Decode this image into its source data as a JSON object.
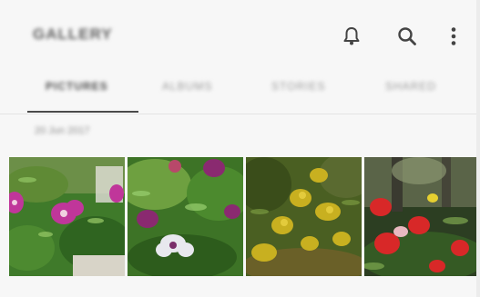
{
  "header": {
    "title": "GALLERY",
    "icons": [
      "bell-icon",
      "search-icon",
      "more-vertical-icon"
    ]
  },
  "tabs": [
    {
      "label": "PICTURES",
      "active": true
    },
    {
      "label": "ALBUMS",
      "active": false
    },
    {
      "label": "STORIES",
      "active": false
    },
    {
      "label": "SHARED",
      "active": false
    }
  ],
  "grid": {
    "date": "20 Jun 2017",
    "thumbnails": [
      "pink-flowers-photo",
      "purple-flowers-photo",
      "yellow-plant-photo",
      "red-flowers-photo"
    ]
  },
  "colors": {
    "background": "#f7f7f7",
    "text_primary": "#4a4a4a",
    "text_secondary": "#9a9a9a",
    "icon": "#444444"
  }
}
